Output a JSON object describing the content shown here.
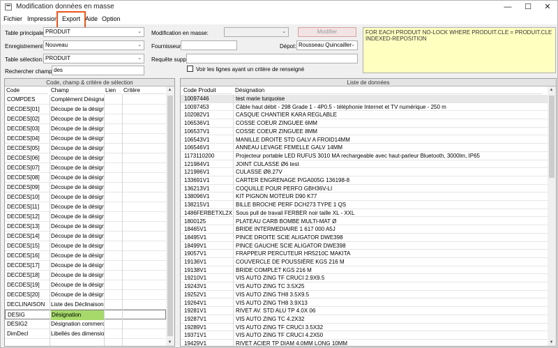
{
  "window": {
    "title": "Modification données en masse",
    "minimize": "—",
    "maximize": "☐",
    "close": "✕"
  },
  "menu": {
    "fichier": "Fichier",
    "impression": "Impression",
    "export": "Export",
    "aide": "Aide",
    "option": "Option"
  },
  "form": {
    "table_principale_label": "Table principale:",
    "table_principale_value": "PRODUIT",
    "enregistrement_label": "Enregistrement:",
    "enregistrement_value": "Nouveau",
    "table_selection_label": "Table sélection:",
    "table_selection_value": "PRODUIT",
    "rechercher_label": "Rechercher champ:",
    "rechercher_value": "des",
    "modification_label": "Modification en masse:",
    "modification_value": "",
    "fournisseur_label": "Fournisseur:",
    "fournisseur_value": "",
    "depot_label": "Dépot:",
    "depot_value": "Rousseau Quincailler",
    "requete_label": "Requête supp:",
    "requete_value": "",
    "checkbox_label": "Voir les lignes ayant un critère de renseigné",
    "modifier_button": "Modifier",
    "query_text": "FOR EACH PRODUIT NO-LOCK WHERE PRODUIT.CLE = PRODUIT.CLE INDEXED-REPOSITION",
    "combo_arrow": "⌄"
  },
  "left_panel": {
    "title": "Code, champ & critère de sélection",
    "headers": {
      "code": "Code",
      "champ": "Champ",
      "lien": "Lien",
      "critere": "Critère"
    },
    "rows": [
      {
        "code": "COMPDES",
        "champ": "Complément Désignation"
      },
      {
        "code": "DECDES[01]",
        "champ": "Découpe de la désignation"
      },
      {
        "code": "DECDES[02]",
        "champ": "Découpe de la désignation"
      },
      {
        "code": "DECDES[03]",
        "champ": "Découpe de la désignation"
      },
      {
        "code": "DECDES[04]",
        "champ": "Découpe de la désignation"
      },
      {
        "code": "DECDES[05]",
        "champ": "Découpe de la désignation"
      },
      {
        "code": "DECDES[06]",
        "champ": "Découpe de la désignation"
      },
      {
        "code": "DECDES[07]",
        "champ": "Découpe de la désignation"
      },
      {
        "code": "DECDES[08]",
        "champ": "Découpe de la désignation"
      },
      {
        "code": "DECDES[09]",
        "champ": "Découpe de la désignation"
      },
      {
        "code": "DECDES[10]",
        "champ": "Découpe de la désignation"
      },
      {
        "code": "DECDES[11]",
        "champ": "Découpe de la désignation"
      },
      {
        "code": "DECDES[12]",
        "champ": "Découpe de la désignation"
      },
      {
        "code": "DECDES[13]",
        "champ": "Découpe de la désignation"
      },
      {
        "code": "DECDES[14]",
        "champ": "Découpe de la désignation"
      },
      {
        "code": "DECDES[15]",
        "champ": "Découpe de la désignation"
      },
      {
        "code": "DECDES[16]",
        "champ": "Découpe de la désignation"
      },
      {
        "code": "DECDES[17]",
        "champ": "Découpe de la désignation"
      },
      {
        "code": "DECDES[18]",
        "champ": "Découpe de la désignation"
      },
      {
        "code": "DECDES[19]",
        "champ": "Découpe de la désignation"
      },
      {
        "code": "DECDES[20]",
        "champ": "Découpe de la désignation"
      },
      {
        "code": "DECLINAISON",
        "champ": "Liste des Déclinaisons"
      },
      {
        "code": "DESIG",
        "champ": "Désignation",
        "selected": true
      },
      {
        "code": "DESIG2",
        "champ": "Désignation commerciale"
      },
      {
        "code": "DimDecl",
        "champ": "Libellés des dimensions"
      }
    ]
  },
  "right_panel": {
    "title": "Liste de données",
    "headers": {
      "code_produit": "Code Produit",
      "designation": "Désignation"
    },
    "rows": [
      {
        "code": "10097446",
        "designation": "test marie turquoise"
      },
      {
        "code": "10097453",
        "designation": "Câble haut débit - 298 Grade 1 - 4P0.5 - téléphonie Internet et TV numérique - 250 m"
      },
      {
        "code": "102082V1",
        "designation": "CASQUE CHANTIER KARA REGLABLE"
      },
      {
        "code": "106536V1",
        "designation": "COSSE COEUR ZINGUEE 6MM"
      },
      {
        "code": "106537V1",
        "designation": "COSSE COEUR ZINGUEE 8MM"
      },
      {
        "code": "106543V1",
        "designation": "MANILLE DROITE STD GALV A FROID14MM"
      },
      {
        "code": "106546V1",
        "designation": "ANNEAU LEVAGE FEMELLE GALV 14MM"
      },
      {
        "code": "1173110200",
        "designation": "Projecteur portable LED RUFUS 3010 MA rechargeable avec haut-parleur Bluetooth, 3000lm, IP65"
      },
      {
        "code": "121984V1",
        "designation": "JOINT CULASSE Ø6 test"
      },
      {
        "code": "121986V1",
        "designation": "CULASSE Ø8.27V"
      },
      {
        "code": "133691V1",
        "designation": "CARTER ENGRENAGE P/GA005G 136198-8"
      },
      {
        "code": "136213V1",
        "designation": "COQUILLE POUR PERFO GBH36V-LI"
      },
      {
        "code": "138096V1",
        "designation": "KIT PIGNON MOTEUR D90 K77"
      },
      {
        "code": "138215V1",
        "designation": "BILLE BROCHE PERF DCH273 TYPE 1 QS"
      },
      {
        "code": "1486FERBETXL2XL",
        "designation": "Sous pull de travail FERBER noir taille XL - XXL"
      },
      {
        "code": "1800125",
        "designation": "PLATEAU CARB BOMBE MULTI-MAT Ø"
      },
      {
        "code": "18465V1",
        "designation": "BRIDE INTERMEDIAIRE 1 617 000 A5J"
      },
      {
        "code": "18495V1",
        "designation": "PINCE DROITE SCIE ALIGATOR DWE398"
      },
      {
        "code": "18499V1",
        "designation": "PINCE GAUCHE SCIE ALIGATOR DWE398"
      },
      {
        "code": "19057V1",
        "designation": "FRAPPEUR PERCUTEUR HR5210C MAKITA"
      },
      {
        "code": "19136V1",
        "designation": "COUVERCLE DE POUSSIÈRE KGS 216 M"
      },
      {
        "code": "19138V1",
        "designation": "BRIDE COMPLET KGS 216 M"
      },
      {
        "code": "19210V1",
        "designation": "VIS AUTO ZING TF CRUCI 2.9X9.5"
      },
      {
        "code": "19243V1",
        "designation": "VIS AUTO ZING TC 3.5X25"
      },
      {
        "code": "19252V1",
        "designation": "VIS AUTO ZING TH8 3.5X9.5"
      },
      {
        "code": "19264V1",
        "designation": "VIS AUTO ZING TH8 3.9X13"
      },
      {
        "code": "19281V1",
        "designation": "RIVET AV. STD ALU TP 4.0X 06"
      },
      {
        "code": "19287V1",
        "designation": "VIS AUTO ZING TC 4.2X32"
      },
      {
        "code": "19289V1",
        "designation": "VIS AUTO ZING TF CRUCI 3.5X32"
      },
      {
        "code": "19371V1",
        "designation": "VIS AUTO ZING TF CRUCI 4.2X50"
      },
      {
        "code": "19429V1",
        "designation": "RIVET ACIER TP DIAM 4.0MM LONG 10MM"
      }
    ]
  },
  "scroll": {
    "up": "▲",
    "down": "▼"
  },
  "colors": {
    "accent_highlight": "#e8541b",
    "selected_row": "#a6d96a",
    "query_bg": "#ffffc0"
  }
}
